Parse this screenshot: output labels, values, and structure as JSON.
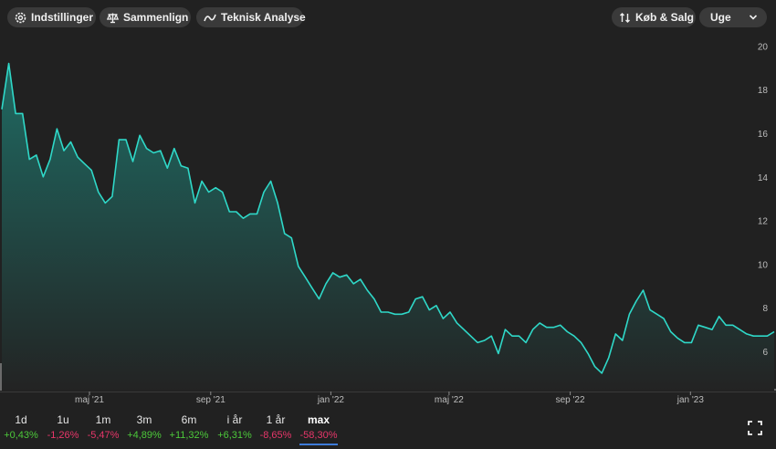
{
  "toolbar": {
    "settings_label": "Indstillinger",
    "compare_label": "Sammenlign",
    "technical_label": "Teknisk Analyse",
    "buy_sell_label": "Køb & Salg",
    "interval_label": "Uge"
  },
  "periods": [
    {
      "label": "1d",
      "change": "+0,43%",
      "color": "#4cc93a"
    },
    {
      "label": "1u",
      "change": "-1,26%",
      "color": "#e8366a"
    },
    {
      "label": "1m",
      "change": "-5,47%",
      "color": "#e8366a"
    },
    {
      "label": "3m",
      "change": "+4,89%",
      "color": "#4cc93a"
    },
    {
      "label": "6m",
      "change": "+11,32%",
      "color": "#4cc93a"
    },
    {
      "label": "i år",
      "change": "+6,31%",
      "color": "#4cc93a"
    },
    {
      "label": "1 år",
      "change": "-8,65%",
      "color": "#e8366a"
    },
    {
      "label": "max",
      "change": "-58,30%",
      "color": "#e8366a",
      "active": true
    }
  ],
  "colors": {
    "line": "#2fd8c8",
    "fill_top": "#1f6e66",
    "fill_bottom": "#232323",
    "volume": "#6b6b6b",
    "background": "#212121"
  },
  "chart_data": {
    "type": "area",
    "x_start": "2021-02-01",
    "interval": "week",
    "y_ticks": [
      6,
      8,
      10,
      12,
      14,
      16,
      18,
      20
    ],
    "ylim": [
      4.2,
      20.6
    ],
    "x_ticks": [
      {
        "date": "2021-05-01",
        "label": "maj '21"
      },
      {
        "date": "2021-09-01",
        "label": "sep '21"
      },
      {
        "date": "2022-01-01",
        "label": "jan '22"
      },
      {
        "date": "2022-05-01",
        "label": "maj '22"
      },
      {
        "date": "2022-09-01",
        "label": "sep '22"
      },
      {
        "date": "2023-01-01",
        "label": "jan '23"
      }
    ],
    "values": [
      17.1,
      19.2,
      16.9,
      16.9,
      14.8,
      15.0,
      14.0,
      14.8,
      16.2,
      15.2,
      15.6,
      14.9,
      14.6,
      14.3,
      13.3,
      12.8,
      13.1,
      15.7,
      15.7,
      14.7,
      15.9,
      15.3,
      15.1,
      15.2,
      14.4,
      15.3,
      14.5,
      14.4,
      12.8,
      13.8,
      13.3,
      13.5,
      13.3,
      12.4,
      12.4,
      12.1,
      12.3,
      12.3,
      13.3,
      13.8,
      12.8,
      11.4,
      11.2,
      9.9,
      9.4,
      8.9,
      8.4,
      9.1,
      9.6,
      9.4,
      9.5,
      9.1,
      9.3,
      8.8,
      8.4,
      7.8,
      7.8,
      7.7,
      7.7,
      7.8,
      8.4,
      8.5,
      7.9,
      8.1,
      7.5,
      7.8,
      7.3,
      7.0,
      6.7,
      6.4,
      6.5,
      6.7,
      5.9,
      7.0,
      6.7,
      6.7,
      6.4,
      7.0,
      7.3,
      7.1,
      7.1,
      7.2,
      6.9,
      6.7,
      6.4,
      5.9,
      5.3,
      5.0,
      5.7,
      6.8,
      6.5,
      7.7,
      8.3,
      8.8,
      7.9,
      7.7,
      7.5,
      6.9,
      6.6,
      6.4,
      6.4,
      7.2,
      7.1,
      7.0,
      7.6,
      7.2,
      7.2,
      7.0,
      6.8,
      6.7,
      6.7,
      6.7,
      6.9
    ],
    "volume": [
      14,
      10,
      6,
      4,
      3,
      2,
      2,
      3,
      2,
      2,
      1,
      2,
      1,
      1,
      1,
      1,
      1,
      1,
      1,
      1,
      1,
      1,
      1,
      1,
      1,
      1,
      1,
      1,
      1,
      1,
      1,
      1,
      1,
      1,
      1,
      1,
      1,
      1,
      1,
      1,
      1,
      1,
      1,
      1,
      1,
      1,
      1,
      1,
      1,
      1,
      1,
      1,
      1,
      1,
      1,
      1,
      1,
      1,
      1,
      1,
      1,
      1,
      1,
      1,
      1,
      1,
      1,
      1,
      1,
      1,
      1,
      1,
      1,
      1,
      1,
      1,
      1,
      1,
      1,
      1,
      1,
      1,
      1,
      1,
      1,
      1,
      1,
      1,
      1,
      1,
      1,
      1,
      1,
      1,
      1,
      1,
      1,
      1,
      1,
      1,
      1,
      1,
      1,
      1,
      1,
      1,
      1,
      1,
      1,
      1,
      1,
      1,
      1
    ]
  }
}
